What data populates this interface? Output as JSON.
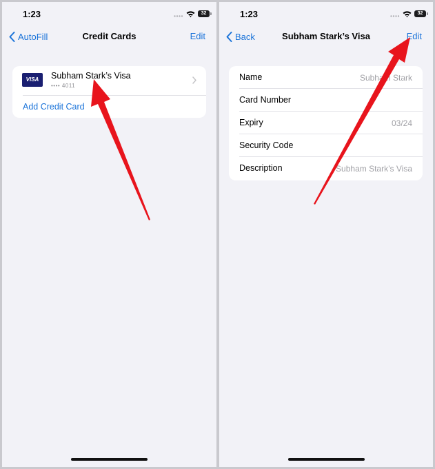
{
  "status_bar": {
    "time": "1:23",
    "battery": "32"
  },
  "left": {
    "back_label": "AutoFill",
    "title": "Credit Cards",
    "action": "Edit",
    "card": {
      "logo_text": "VISA",
      "name": "Subham Stark’s Visa",
      "digits": "•••• 4011"
    },
    "add_card": "Add Credit Card"
  },
  "right": {
    "back_label": "Back",
    "title": "Subham Stark’s Visa",
    "action": "Edit",
    "fields": [
      {
        "label": "Name",
        "value": "Subham Stark"
      },
      {
        "label": "Card Number",
        "value": ""
      },
      {
        "label": "Expiry",
        "value": "03/24"
      },
      {
        "label": "Security Code",
        "value": ""
      },
      {
        "label": "Description",
        "value": "Subham Stark’s Visa"
      }
    ]
  },
  "colors": {
    "accent": "#1a73d9",
    "arrow": "#e8141c",
    "visa": "#1a1f71",
    "background": "#f2f2f7"
  },
  "icons": [
    "chevron-left-icon",
    "chevron-right-icon",
    "wifi-icon",
    "battery-icon",
    "signal-icon"
  ]
}
